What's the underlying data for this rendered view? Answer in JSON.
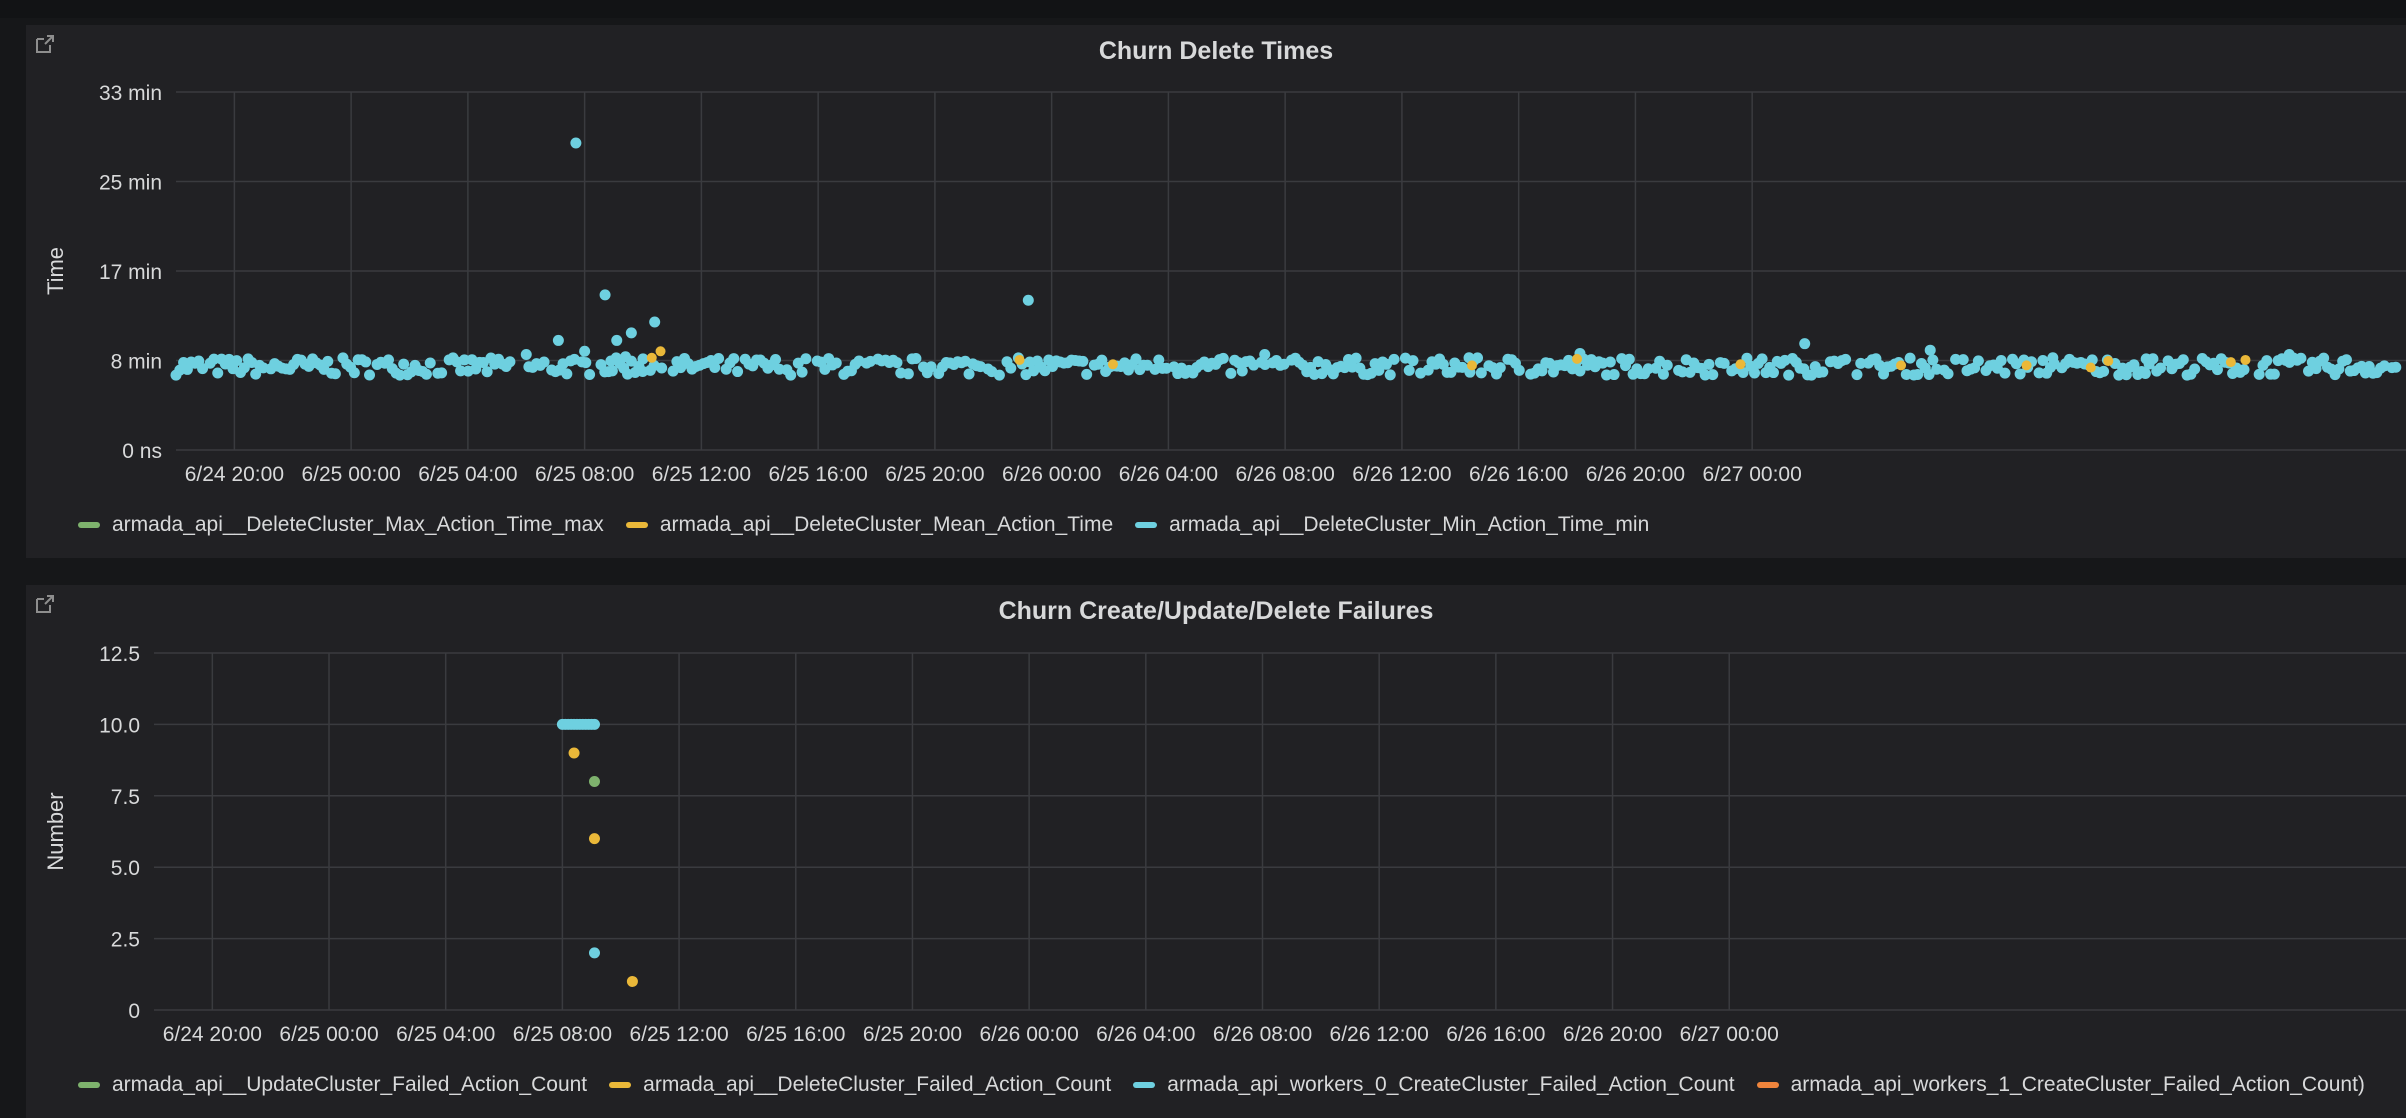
{
  "colors": {
    "green": "#7eb26d",
    "yellow": "#eab839",
    "cyan": "#6ed0e0",
    "orange": "#ef843c",
    "grid": "#3a3b3f",
    "panel_bg": "#212124"
  },
  "panels": [
    {
      "title": "Churn Delete Times",
      "link_icon": "external-link-icon",
      "legend": [
        {
          "label": "armada_api__DeleteCluster_Max_Action_Time_max",
          "color": "#7eb26d"
        },
        {
          "label": "armada_api__DeleteCluster_Mean_Action_Time",
          "color": "#eab839"
        },
        {
          "label": "armada_api__DeleteCluster_Min_Action_Time_min",
          "color": "#6ed0e0"
        }
      ]
    },
    {
      "title": "Churn Create/Update/Delete Failures",
      "link_icon": "external-link-icon",
      "legend": [
        {
          "label": "armada_api__UpdateCluster_Failed_Action_Count",
          "color": "#7eb26d"
        },
        {
          "label": "armada_api__DeleteCluster_Failed_Action_Count",
          "color": "#eab839"
        },
        {
          "label": "armada_api_workers_0_CreateCluster_Failed_Action_Count",
          "color": "#6ed0e0"
        },
        {
          "label": "armada_api_workers_1_CreateCluster_Failed_Action_Count)",
          "color": "#ef843c"
        }
      ]
    }
  ],
  "chart_data": [
    {
      "type": "scatter",
      "title": "Churn Delete Times",
      "ylabel": "Time",
      "xlabel": "",
      "x_ticks": [
        "6/24 20:00",
        "6/25 00:00",
        "6/25 04:00",
        "6/25 08:00",
        "6/25 12:00",
        "6/25 16:00",
        "6/25 20:00",
        "6/26 00:00",
        "6/26 04:00",
        "6/26 08:00",
        "6/26 12:00",
        "6/26 16:00",
        "6/26 20:00",
        "6/27 00:00"
      ],
      "y_ticks": [
        "0 ns",
        "8 min",
        "17 min",
        "25 min",
        "33 min"
      ],
      "ylim_min": [
        0,
        33
      ],
      "x_range_hours_from_6_24_18_00": [
        0,
        76.4
      ],
      "grid": true,
      "legend_position": "bottom-left",
      "series": [
        {
          "name": "armada_api__DeleteCluster_Max_Action_Time_max",
          "points_h_min": []
        },
        {
          "name": "armada_api__DeleteCluster_Mean_Action_Time",
          "points_h_min": [
            [
              16.3,
              8.5
            ],
            [
              16.6,
              9.1
            ],
            [
              28.9,
              8.3
            ],
            [
              32.1,
              7.9
            ],
            [
              44.4,
              7.8
            ],
            [
              48.0,
              8.4
            ],
            [
              53.6,
              7.9
            ],
            [
              59.1,
              7.8
            ],
            [
              63.4,
              7.8
            ],
            [
              65.6,
              7.6
            ],
            [
              66.2,
              8.2
            ],
            [
              70.4,
              8.1
            ],
            [
              70.9,
              8.3
            ]
          ]
        },
        {
          "name": "armada_api__DeleteCluster_Min_Action_Time_min",
          "baseline_min": 7.7,
          "outliers_h_min": [
            [
              13.7,
              28.3
            ],
            [
              14.7,
              14.3
            ],
            [
              13.1,
              10.1
            ],
            [
              15.1,
              10.1
            ],
            [
              15.6,
              10.8
            ],
            [
              16.4,
              11.8
            ],
            [
              29.2,
              13.8
            ],
            [
              14.9,
              8.2
            ],
            [
              15.4,
              8.6
            ],
            [
              16.0,
              8.4
            ],
            [
              14.0,
              9.1
            ],
            [
              12.0,
              8.8
            ],
            [
              55.8,
              9.8
            ],
            [
              60.1,
              9.2
            ],
            [
              48.1,
              8.9
            ],
            [
              44.3,
              8.5
            ],
            [
              37.3,
              8.8
            ],
            [
              64.3,
              8.5
            ],
            [
              67.5,
              8.4
            ],
            [
              72.4,
              8.8
            ]
          ]
        }
      ]
    },
    {
      "type": "scatter",
      "title": "Churn Create/Update/Delete Failures",
      "ylabel": "Number",
      "xlabel": "",
      "x_ticks": [
        "6/24 20:00",
        "6/25 00:00",
        "6/25 04:00",
        "6/25 08:00",
        "6/25 12:00",
        "6/25 16:00",
        "6/25 20:00",
        "6/26 00:00",
        "6/26 04:00",
        "6/26 08:00",
        "6/26 12:00",
        "6/26 16:00",
        "6/26 20:00",
        "6/27 00:00"
      ],
      "y_ticks": [
        "0",
        "2.5",
        "5.0",
        "7.5",
        "10.0",
        "12.5"
      ],
      "ylim": [
        0,
        12.5
      ],
      "grid": true,
      "legend_position": "bottom-left",
      "series": [
        {
          "name": "armada_api__UpdateCluster_Failed_Action_Count",
          "points_h": [
            [
              15.1,
              8
            ]
          ]
        },
        {
          "name": "armada_api__DeleteCluster_Failed_Action_Count",
          "points_h": [
            [
              14.4,
              9
            ],
            [
              15.1,
              6
            ],
            [
              16.4,
              1
            ]
          ]
        },
        {
          "name": "armada_api_workers_0_CreateCluster_Failed_Action_Count",
          "points_h": [
            [
              14.0,
              10
            ],
            [
              14.1,
              10
            ],
            [
              14.2,
              10
            ],
            [
              14.3,
              10
            ],
            [
              14.4,
              10
            ],
            [
              14.5,
              10
            ],
            [
              14.6,
              10
            ],
            [
              14.7,
              10
            ],
            [
              14.8,
              10
            ],
            [
              14.9,
              10
            ],
            [
              15.0,
              10
            ],
            [
              15.1,
              10
            ],
            [
              15.1,
              2
            ]
          ]
        },
        {
          "name": "armada_api_workers_1_CreateCluster_Failed_Action_Count)",
          "points_h": []
        }
      ]
    }
  ]
}
